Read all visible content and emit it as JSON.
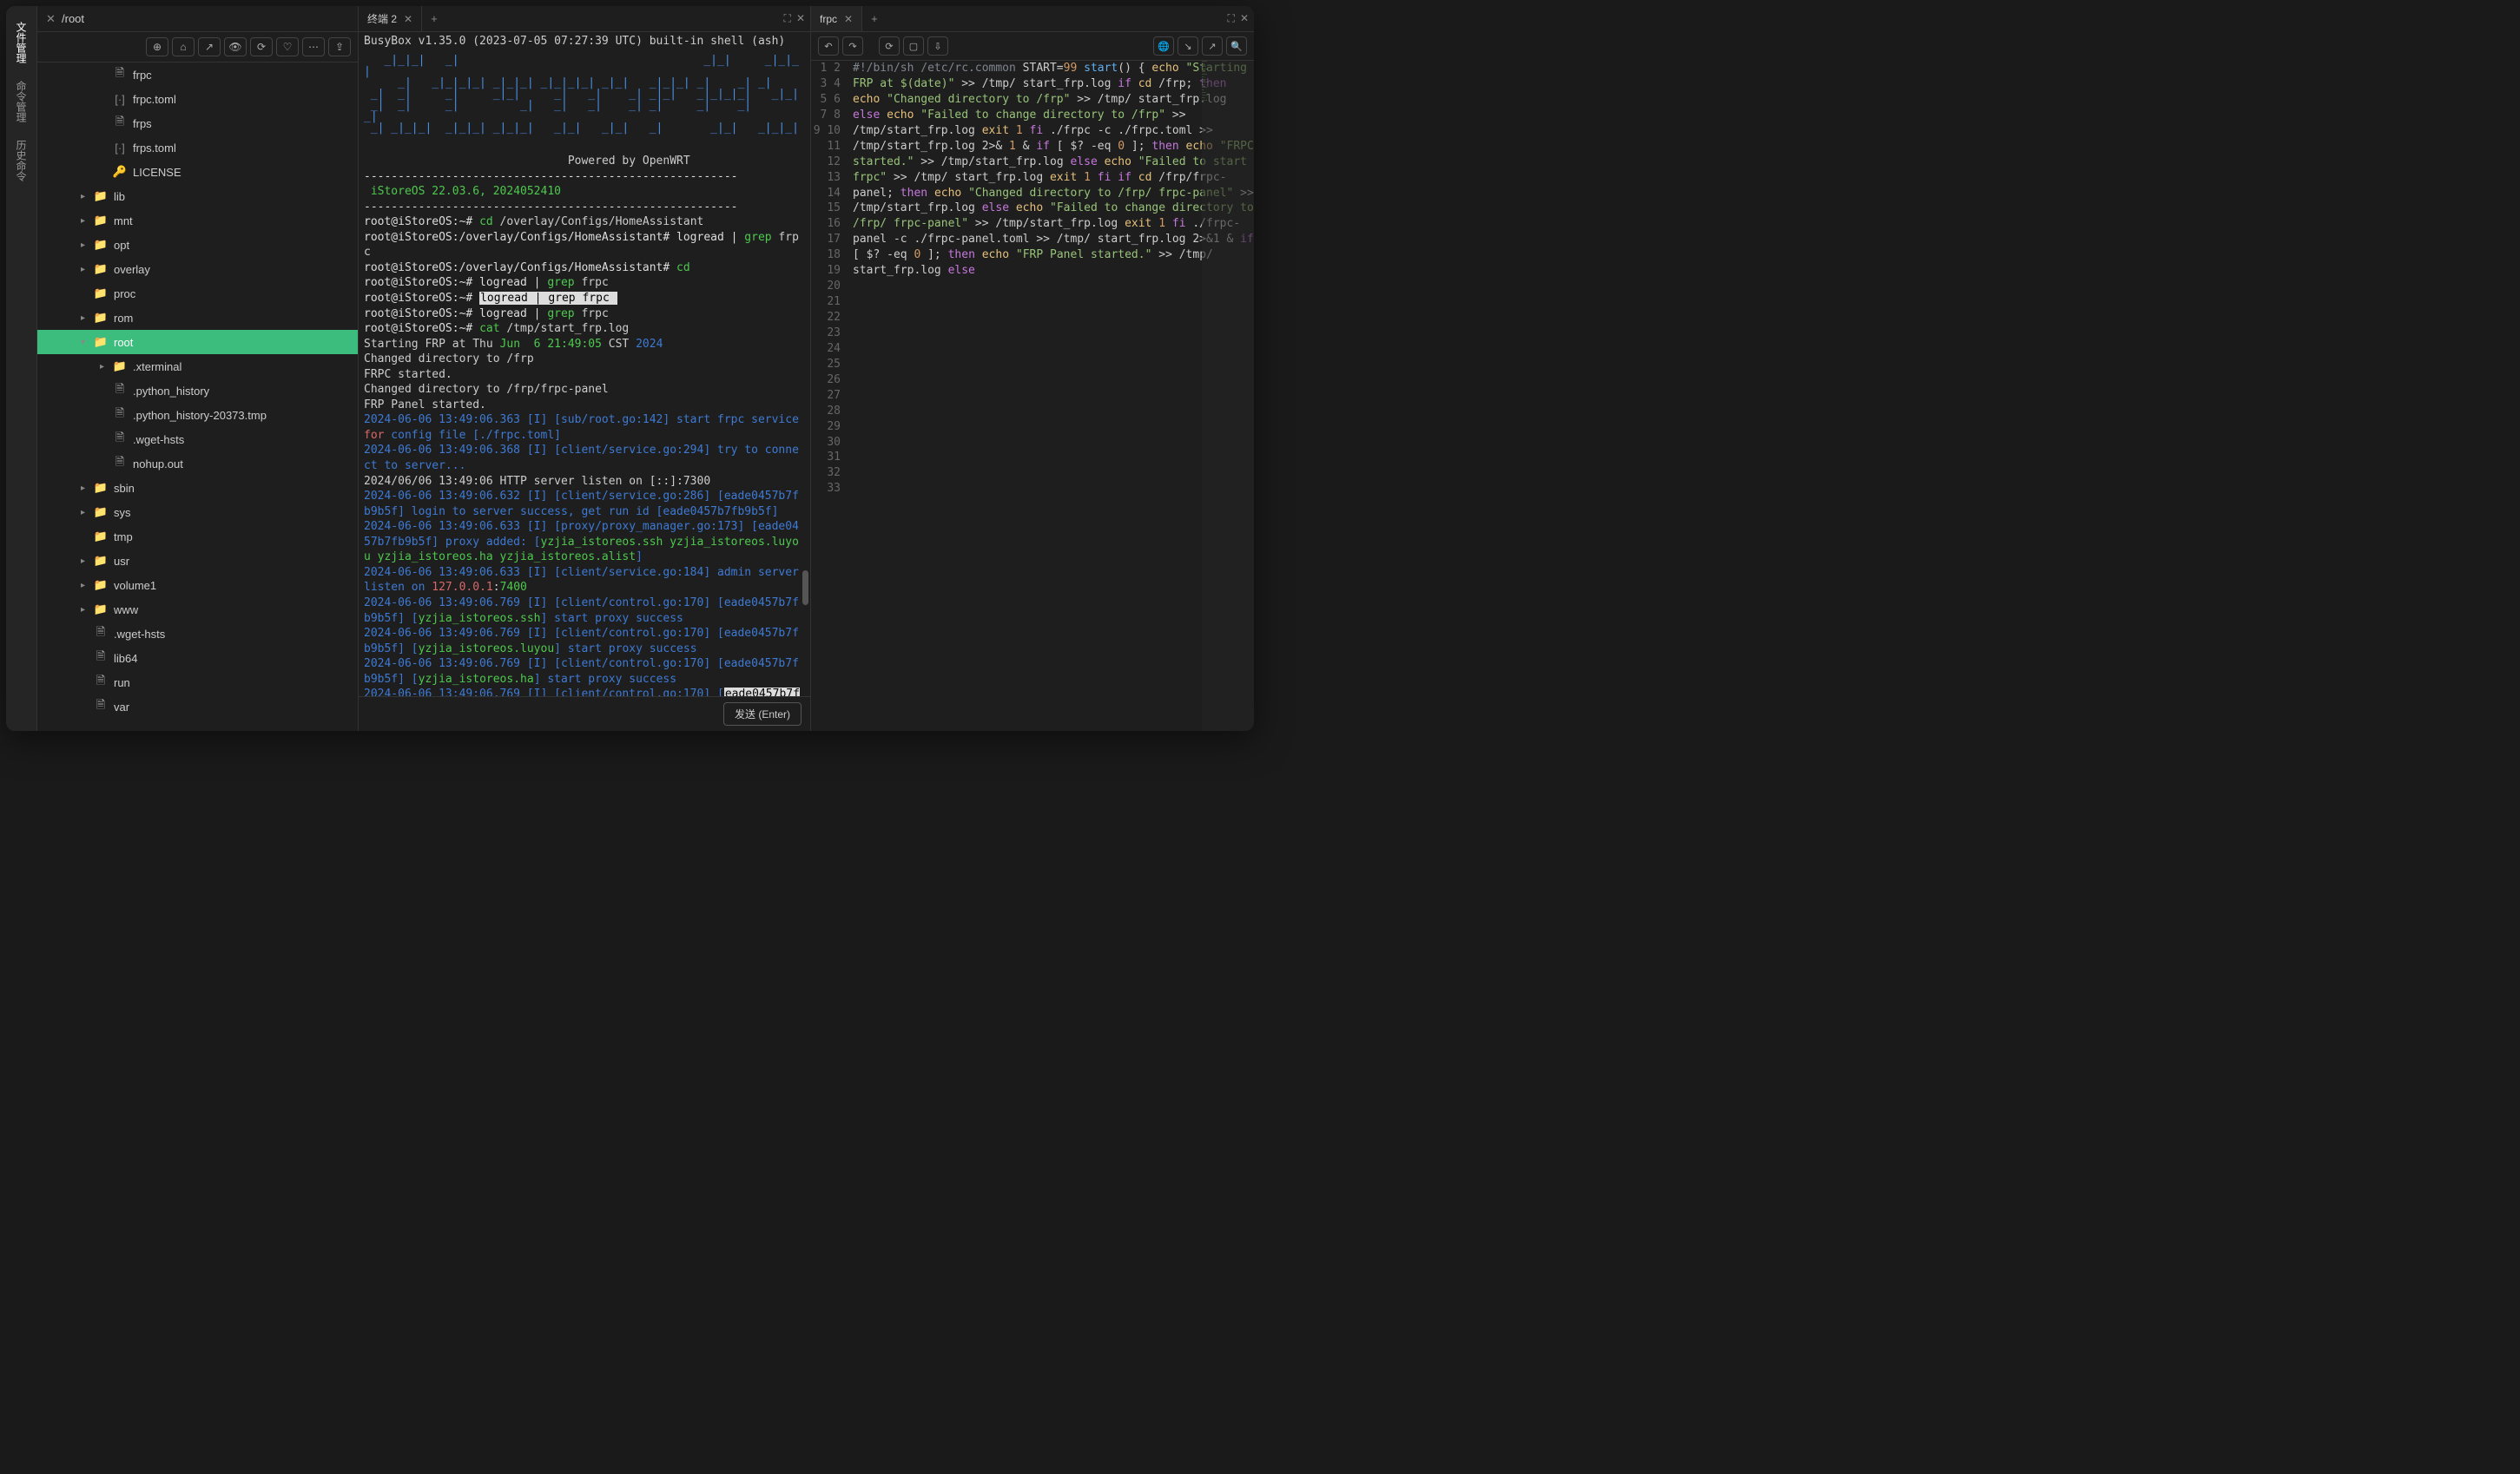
{
  "activity": {
    "tabs": [
      "文件管理",
      "命令管理",
      "历史命令"
    ]
  },
  "path_bar": {
    "path": "/root"
  },
  "toolbar_icons": [
    "target",
    "home",
    "expand",
    "eye",
    "refresh",
    "heart",
    "more",
    "upload"
  ],
  "file_tree": [
    {
      "depth": 3,
      "type": "file",
      "name": "frpc"
    },
    {
      "depth": 3,
      "type": "toml",
      "name": "frpc.toml"
    },
    {
      "depth": 3,
      "type": "file",
      "name": "frps"
    },
    {
      "depth": 3,
      "type": "toml",
      "name": "frps.toml"
    },
    {
      "depth": 3,
      "type": "key",
      "name": "LICENSE"
    },
    {
      "depth": 2,
      "type": "folder",
      "name": "lib",
      "chev": "▸"
    },
    {
      "depth": 2,
      "type": "folder",
      "name": "mnt",
      "chev": "▸"
    },
    {
      "depth": 2,
      "type": "folder",
      "name": "opt",
      "chev": "▸"
    },
    {
      "depth": 2,
      "type": "folder",
      "name": "overlay",
      "chev": "▸"
    },
    {
      "depth": 2,
      "type": "folder",
      "name": "proc",
      "chev": ""
    },
    {
      "depth": 2,
      "type": "folder",
      "name": "rom",
      "chev": "▸"
    },
    {
      "depth": 2,
      "type": "folder",
      "name": "root",
      "chev": "▾",
      "selected": true
    },
    {
      "depth": 3,
      "type": "folder",
      "name": ".xterminal",
      "chev": "▸",
      "tinted": true
    },
    {
      "depth": 3,
      "type": "file",
      "name": ".python_history"
    },
    {
      "depth": 3,
      "type": "file",
      "name": ".python_history-20373.tmp"
    },
    {
      "depth": 3,
      "type": "file",
      "name": ".wget-hsts"
    },
    {
      "depth": 3,
      "type": "file",
      "name": "nohup.out"
    },
    {
      "depth": 2,
      "type": "folder",
      "name": "sbin",
      "chev": "▸"
    },
    {
      "depth": 2,
      "type": "folder",
      "name": "sys",
      "chev": "▸"
    },
    {
      "depth": 2,
      "type": "folder",
      "name": "tmp",
      "chev": ""
    },
    {
      "depth": 2,
      "type": "folder",
      "name": "usr",
      "chev": "▸"
    },
    {
      "depth": 2,
      "type": "folder",
      "name": "volume1",
      "chev": "▸"
    },
    {
      "depth": 2,
      "type": "folder",
      "name": "www",
      "chev": "▸"
    },
    {
      "depth": 2,
      "type": "file",
      "name": ".wget-hsts"
    },
    {
      "depth": 2,
      "type": "file",
      "name": "lib64"
    },
    {
      "depth": 2,
      "type": "file",
      "name": "run"
    },
    {
      "depth": 2,
      "type": "file",
      "name": "var"
    }
  ],
  "terminal": {
    "tab_label": "终端 2",
    "busybox_line": "BusyBox v1.35.0 (2023-07-05 07:27:39 UTC) built-in shell (ash)",
    "powered": "Powered by OpenWRT",
    "version": " iStoreOS 22.03.6, 2024052410",
    "send_label": "发送 (Enter)"
  },
  "editor": {
    "tab_label": "frpc",
    "toolbar_icons_left": [
      "undo",
      "redo"
    ],
    "toolbar_icons_mid": [
      "refresh",
      "save",
      "download"
    ],
    "toolbar_icons_right": [
      "globe",
      "diag1",
      "diag2",
      "search"
    ]
  }
}
